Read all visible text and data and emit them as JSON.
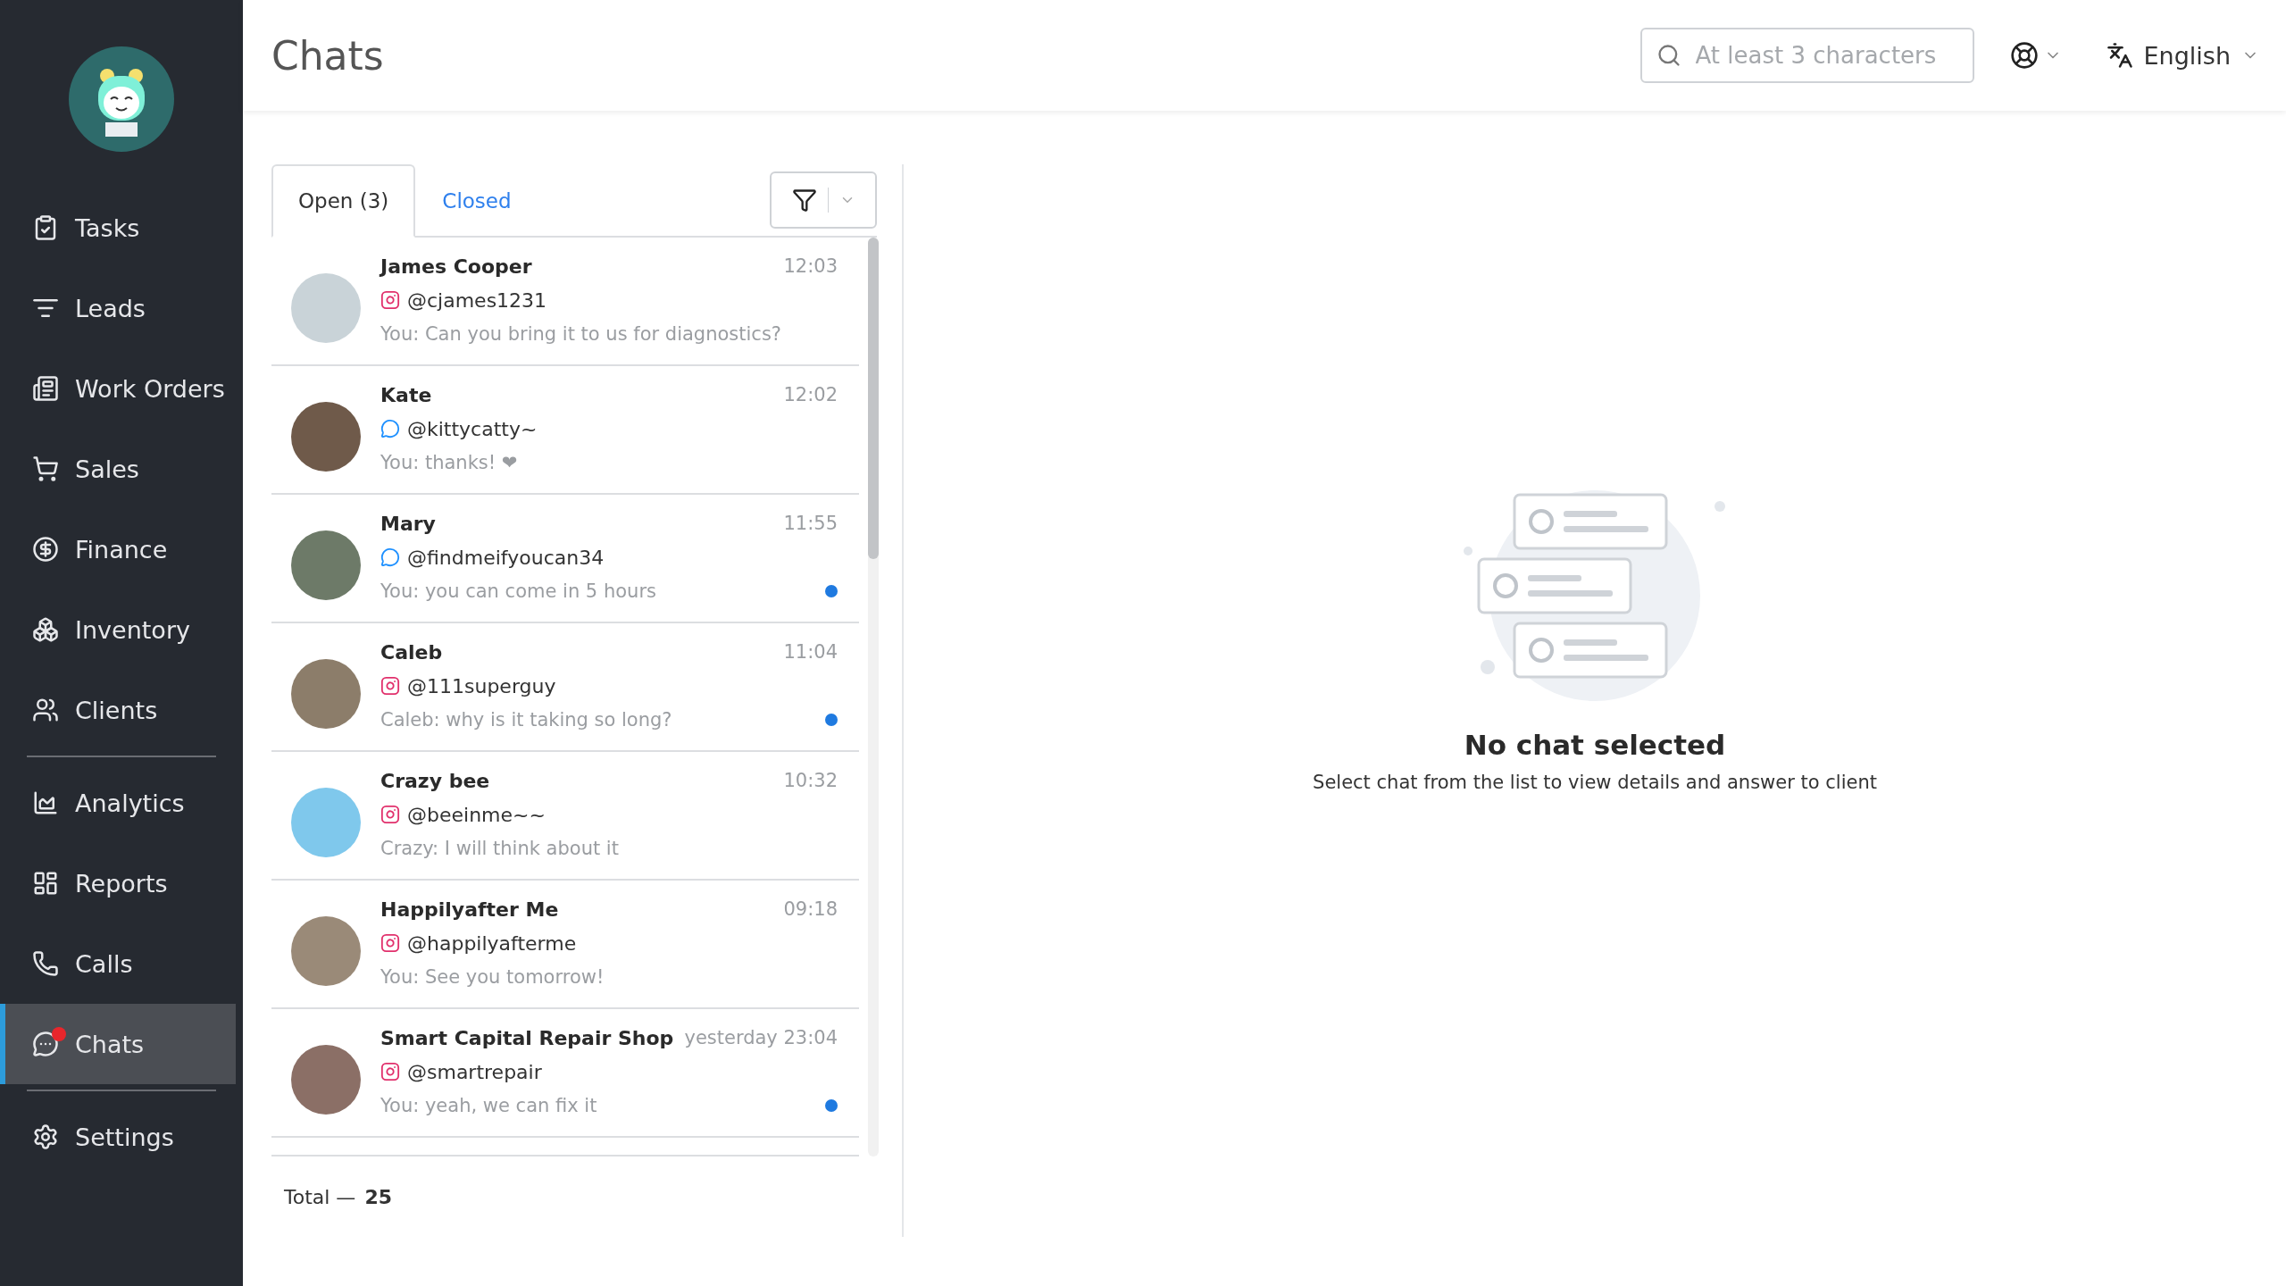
{
  "sidebar": {
    "items": [
      {
        "label": "Tasks",
        "selected": false,
        "badge": false,
        "divider_after": false
      },
      {
        "label": "Leads",
        "selected": false,
        "badge": false,
        "divider_after": false
      },
      {
        "label": "Work Orders",
        "selected": false,
        "badge": false,
        "divider_after": false
      },
      {
        "label": "Sales",
        "selected": false,
        "badge": false,
        "divider_after": false
      },
      {
        "label": "Finance",
        "selected": false,
        "badge": false,
        "divider_after": false
      },
      {
        "label": "Inventory",
        "selected": false,
        "badge": false,
        "divider_after": false
      },
      {
        "label": "Clients",
        "selected": false,
        "badge": false,
        "divider_after": true
      },
      {
        "label": "Analytics",
        "selected": false,
        "badge": false,
        "divider_after": false
      },
      {
        "label": "Reports",
        "selected": false,
        "badge": false,
        "divider_after": false
      },
      {
        "label": "Calls",
        "selected": false,
        "badge": false,
        "divider_after": false
      },
      {
        "label": "Chats",
        "selected": true,
        "badge": true,
        "divider_after": true
      },
      {
        "label": "Settings",
        "selected": false,
        "badge": false,
        "divider_after": false
      }
    ]
  },
  "header": {
    "title": "Chats",
    "search": {
      "placeholder": "At least 3 characters"
    },
    "language": "English"
  },
  "tabs": [
    {
      "label": "Open (3)",
      "selected": true
    },
    {
      "label": "Closed",
      "selected": false
    }
  ],
  "chats": [
    {
      "name": "James Cooper",
      "time": "12:03",
      "kind": "instagram",
      "handle": "@cjames1231",
      "message": "You: Can you bring it to us for diagnostics?",
      "unread": false
    },
    {
      "name": "Kate",
      "time": "12:02",
      "kind": "messenger",
      "handle": "@kittycatty~",
      "message": "You: thanks! ❤",
      "unread": false
    },
    {
      "name": "Mary",
      "time": "11:55",
      "kind": "messenger",
      "handle": "@findmeifyoucan34",
      "message": "You: you can come in 5 hours",
      "unread": true
    },
    {
      "name": "Caleb",
      "time": "11:04",
      "kind": "instagram",
      "handle": "@111superguy",
      "message": "Caleb: why is it taking so long?",
      "unread": true
    },
    {
      "name": "Crazy bee",
      "time": "10:32",
      "kind": "instagram",
      "handle": "@beeinme~~",
      "message": "Crazy: I will think about it",
      "unread": false
    },
    {
      "name": "Happilyafter Me",
      "time": "09:18",
      "kind": "instagram",
      "handle": "@happilyafterme",
      "message": "You: See you tomorrow!",
      "unread": false
    },
    {
      "name": "Smart Capital Repair Shop",
      "time": "yesterday 23:04",
      "kind": "instagram",
      "handle": "@smartrepair",
      "message": "You: yeah, we can fix it",
      "unread": true
    }
  ],
  "total": {
    "label": "Total —",
    "value": "25"
  },
  "empty_state": {
    "title": "No chat selected",
    "text": "Select chat from the list to view details and answer to client"
  }
}
